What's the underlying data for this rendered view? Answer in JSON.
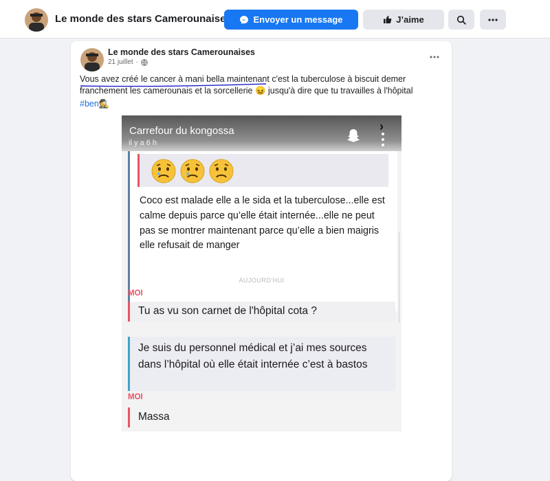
{
  "header": {
    "page_name": "Le monde des stars Camerounaises",
    "message_button": "Envoyer un message",
    "like_button": "J’aime"
  },
  "post": {
    "author": "Le monde des stars Camerounaises",
    "date": "21 juillet",
    "text_line1": "Vous avez créé le cancer à mani bella maintenant c'est la tuberculose à biscuit demer",
    "text_line2": "franchement les camerounais et la sorcellerie 😖 jusqu'à dire que tu travailles à l'hôpital",
    "hashtag": "#ben🕵",
    "screenshot": {
      "chat_title": "Carrefour du kongossa",
      "time": "il y a 6 h",
      "message1": "Coco est malade elle a le sida et la tuberculose...elle est calme depuis parce qu’elle était internée...elle ne peut pas se montrer maintenant parce qu’elle a bien maigris elle refusait de manger",
      "day_divider": "AUJOURD'HUI",
      "sender_me_1": "MOI",
      "reply1": "Tu as vu son carnet de l'hôpital cota ?",
      "message2": "Je suis du personnel médical et j’ai mes sources dans l’hôpital où elle était internée c’est à bastos",
      "sender_me_2": "MOI",
      "reply2": "Massa"
    }
  },
  "colors": {
    "brand_blue": "#1877f2",
    "accent_red": "#e85466",
    "accent_teal": "#3fa3c8",
    "underline_blue": "#1d1dc8"
  },
  "icons": [
    "messenger-icon",
    "thumbs-up-icon",
    "search-icon",
    "more-icon",
    "globe-icon",
    "snapchat-ghost-icon",
    "chevron-icon",
    "sad-emoji-icon"
  ]
}
